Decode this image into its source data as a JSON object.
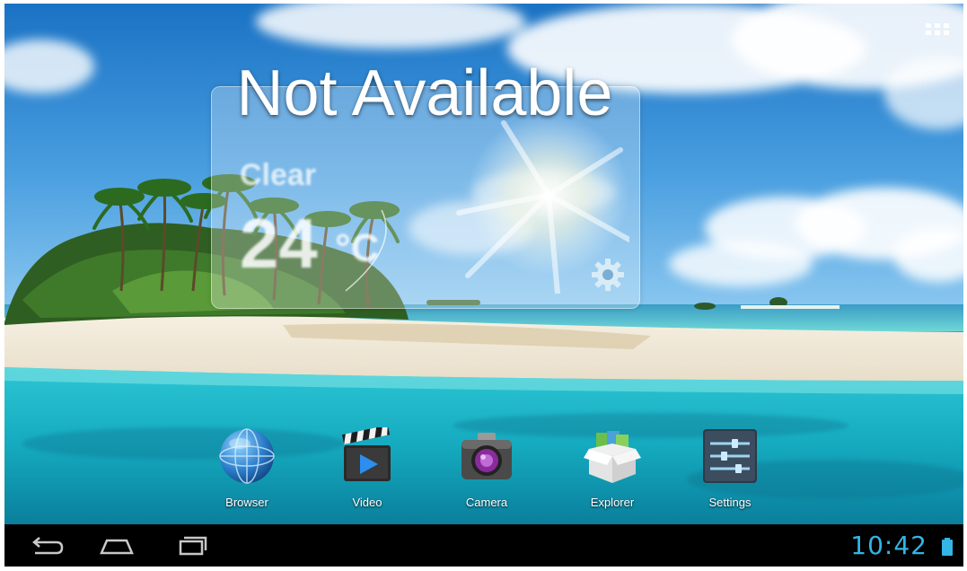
{
  "colors": {
    "accent": "#33b5e5",
    "navbar_bg": "#000000",
    "label_text": "#ffffff"
  },
  "apps_button": {
    "icon": "apps-grid-icon"
  },
  "weather": {
    "title": "Not Available",
    "condition": "Clear",
    "temperature": "24",
    "unit": "°C",
    "icon": "sun-icon",
    "settings_icon": "gear-icon"
  },
  "dock": {
    "items": [
      {
        "label": "Browser",
        "icon": "globe-icon"
      },
      {
        "label": "Video",
        "icon": "clapperboard-icon"
      },
      {
        "label": "Camera",
        "icon": "camera-icon"
      },
      {
        "label": "Explorer",
        "icon": "folder-box-icon"
      },
      {
        "label": "Settings",
        "icon": "sliders-icon"
      }
    ]
  },
  "navbar": {
    "back_icon": "back-icon",
    "home_icon": "home-icon",
    "recents_icon": "recent-apps-icon",
    "time": "10:42",
    "battery_icon": "battery-icon",
    "battery_level": 1.0
  }
}
